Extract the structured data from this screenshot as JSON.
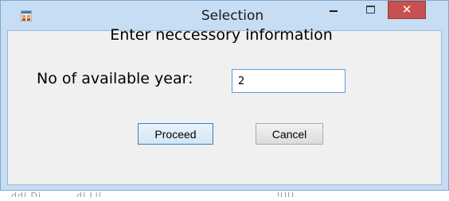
{
  "window": {
    "title": "Selection",
    "app_icon": "form-app-icon",
    "controls": {
      "minimize_icon": "minimize-icon",
      "maximize_icon": "maximize-icon",
      "close_icon": "close-icon",
      "close_glyph": "✕"
    }
  },
  "dialog": {
    "heading": "Enter neccessory information",
    "field_label": "No of available year:",
    "field_value": "2"
  },
  "buttons": {
    "proceed_label": "Proceed",
    "cancel_label": "Cancel"
  },
  "background_text": [
    "ddl Di",
    "dl Lll",
    "lUU"
  ],
  "colors": {
    "close_button": "#c75050",
    "window_frame": "#c7ddf3",
    "input_border": "#569de5",
    "default_button_border": "#3c7fb1"
  }
}
